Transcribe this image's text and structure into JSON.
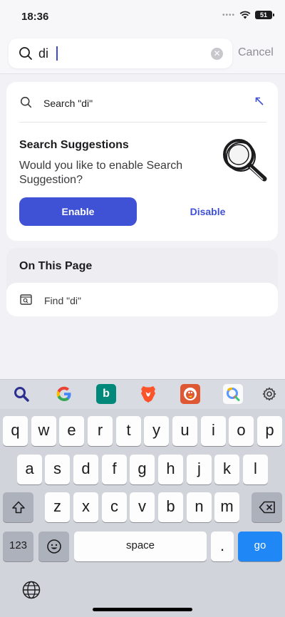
{
  "status": {
    "time": "18:36",
    "battery": "51"
  },
  "search": {
    "value": "di",
    "cancel_label": "Cancel"
  },
  "suggestions": {
    "search_row_label": "Search \"di\"",
    "title": "Search Suggestions",
    "body": "Would you like to enable Search Suggestion?",
    "enable_label": "Enable",
    "disable_label": "Disable"
  },
  "on_this_page": {
    "title": "On This Page",
    "find_label": "Find \"di\""
  },
  "engines": [
    "firefox-search-icon",
    "google-icon",
    "bing-icon",
    "brave-icon",
    "duckduckgo-icon",
    "qwant-icon",
    "settings-gear-icon"
  ],
  "keyboard": {
    "row1": [
      "q",
      "w",
      "e",
      "r",
      "t",
      "y",
      "u",
      "i",
      "o",
      "p"
    ],
    "row2": [
      "a",
      "s",
      "d",
      "f",
      "g",
      "h",
      "j",
      "k",
      "l"
    ],
    "row3": [
      "z",
      "x",
      "c",
      "v",
      "b",
      "n",
      "m"
    ],
    "numbers_label": "123",
    "space_label": "space",
    "period_label": ".",
    "go_label": "go"
  },
  "colors": {
    "accent": "#3f51d4",
    "go": "#1f87f6"
  }
}
